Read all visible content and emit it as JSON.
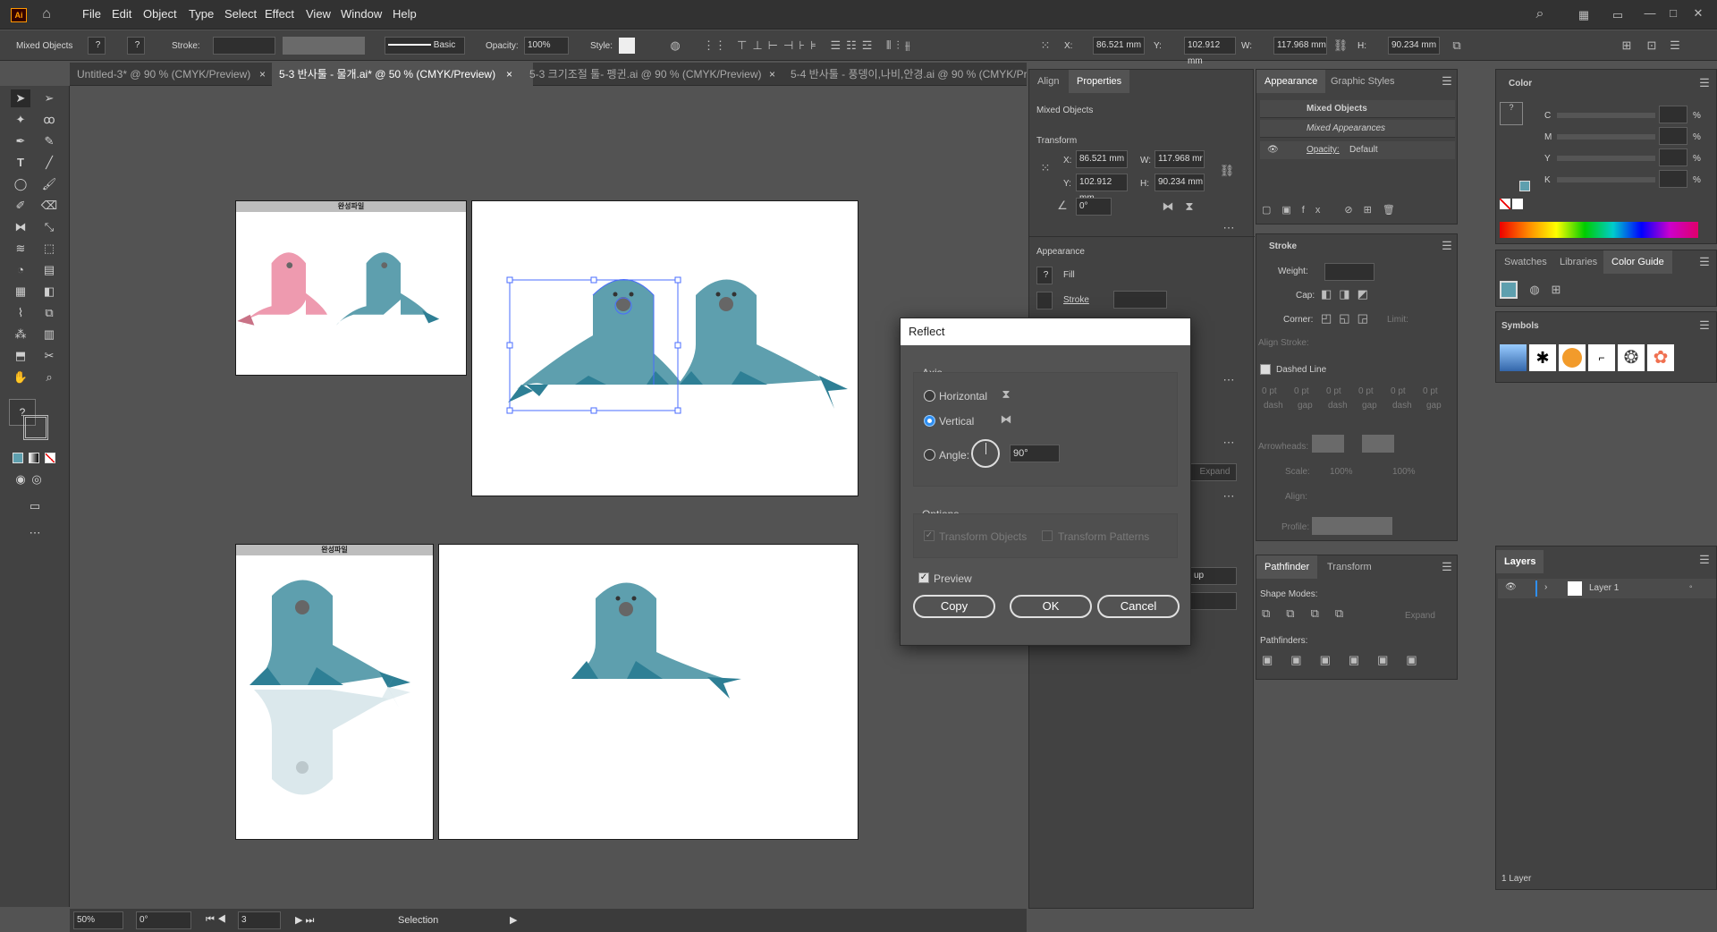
{
  "app": {
    "logo": "Ai",
    "home_icon": "home-icon"
  },
  "menu": [
    "File",
    "Edit",
    "Object",
    "Type",
    "Select",
    "Effect",
    "View",
    "Window",
    "Help"
  ],
  "control": {
    "selection_label": "Mixed Objects",
    "stroke_label": "Stroke:",
    "brush_label": "Basic",
    "opacity_label": "Opacity:",
    "opacity_value": "100%",
    "style_label": "Style:",
    "x_label": "X:",
    "x_value": "86.521 mm",
    "y_label": "Y:",
    "y_value": "102.912 mm",
    "w_label": "W:",
    "w_value": "117.968 mm",
    "h_label": "H:",
    "h_value": "90.234 mm"
  },
  "tabs": [
    "Untitled-3* @ 90 % (CMYK/Preview)",
    "5-3 반사툴 - 물개.ai* @ 50 % (CMYK/Preview)",
    "5-3 크기조절 툴- 펭귄.ai @ 90 % (CMYK/Preview)",
    "5-4 반사툴 - 풍뎅이,나비,안경.ai @ 90 % (CMYK/Pr"
  ],
  "artboard_titles": [
    "완성파일",
    "완성파일"
  ],
  "status": {
    "zoom": "50%",
    "rotation": "0°",
    "artboard_num": "3",
    "tool": "Selection"
  },
  "properties": {
    "tabs": [
      "Align",
      "Properties"
    ],
    "selection": "Mixed Objects",
    "transform_label": "Transform",
    "x_label": "X:",
    "x": "86.521 mm",
    "y_label": "Y:",
    "y": "102.912 mm",
    "w_label": "W:",
    "w": "117.968 mr",
    "h_label": "H:",
    "h": "90.234 mm",
    "angle": "0°",
    "appearance_label": "Appearance",
    "fill_label": "Fill",
    "stroke_label": "Stroke",
    "expand_label": "Expand",
    "group_label": "up"
  },
  "appearance_panel": {
    "tabs": [
      "Appearance",
      "Graphic Styles"
    ],
    "rows": [
      "Mixed Objects",
      "Mixed Appearances"
    ],
    "opacity_label": "Opacity:",
    "opacity_value": "Default"
  },
  "stroke_panel": {
    "title": "Stroke",
    "weight": "Weight:",
    "cap": "Cap:",
    "corner": "Corner:",
    "limit": "Limit:",
    "align": "Align Stroke:",
    "dashed": "Dashed Line",
    "dash_cells": [
      "0 pt",
      "0 pt",
      "0 pt",
      "0 pt",
      "0 pt",
      "0 pt"
    ],
    "dash_labels": [
      "dash",
      "gap",
      "dash",
      "gap",
      "dash",
      "gap"
    ],
    "arrowheads": "Arrowheads:",
    "scale": "Scale:",
    "scale_a": "100%",
    "scale_b": "100%",
    "align2": "Align:",
    "profile": "Profile:"
  },
  "pathfinder_panel": {
    "tabs": [
      "Pathfinder",
      "Transform"
    ],
    "shape_modes": "Shape Modes:",
    "expand": "Expand",
    "pathfinders": "Pathfinders:"
  },
  "color_panel": {
    "title": "Color",
    "channels": [
      "C",
      "M",
      "Y",
      "K"
    ],
    "pct": "%"
  },
  "swatch_tabs": [
    "Swatches",
    "Libraries",
    "Color Guide"
  ],
  "symbols_title": "Symbols",
  "layers": {
    "title": "Layers",
    "layer_name": "Layer 1",
    "count": "1 Layer"
  },
  "dialog": {
    "title": "Reflect",
    "axis_label": "Axis",
    "horizontal": "Horizontal",
    "vertical": "Vertical",
    "angle_label": "Angle:",
    "angle_value": "90°",
    "options_label": "Options",
    "transform_objects": "Transform Objects",
    "transform_patterns": "Transform Patterns",
    "preview": "Preview",
    "copy": "Copy",
    "ok": "OK",
    "cancel": "Cancel",
    "selected_axis": "vertical",
    "preview_checked": true
  },
  "colors": {
    "seal": "#5e9fae",
    "seal_dark": "#2e7f95",
    "seal_pink": "#ee9aaf",
    "accent": "#2f8ff2",
    "selection": "#4a6cff"
  }
}
